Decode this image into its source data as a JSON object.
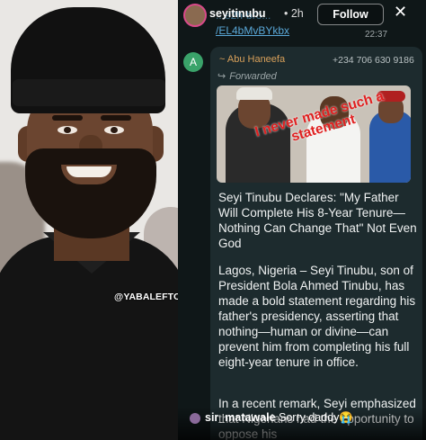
{
  "story": {
    "username": "seyitinubu",
    "age": "2h",
    "follow_label": "Follow",
    "close_glyph": "✕"
  },
  "chat": {
    "partial_link_line1": "...e2h-bro...",
    "partial_link_line2": "/EL4bMvBYkbx",
    "time": "22:37",
    "avatar_letter": "A",
    "sender": "~ Abu Haneefa",
    "phone": "+234 706 630 9186",
    "forwarded_label": "Forwarded",
    "stamp_text": "I never made such a statement",
    "headline": "Seyi Tinubu Declares: \"My Father Will Complete His 8-Year Tenure—Nothing Can Change That\" Not Even God",
    "paragraph1": "Lagos, Nigeria – Seyi Tinubu, son of President Bola Ahmed Tinubu, has made a bold statement regarding his father's presidency, asserting that nothing—human or divine—can prevent him from completing his full eight-year tenure in office.",
    "paragraph2": "In a recent remark, Seyi emphasized that Nigerians had the opportunity to oppose his"
  },
  "photo_watermark": "@YABALEFTONLINE",
  "comment": {
    "user": "sir_matawale",
    "text": "Sorry daddy😭"
  },
  "colors": {
    "bubble": "#1d2b2e",
    "sender": "#d8a05a",
    "link": "#5aa8d8",
    "stamp": "#e02020"
  }
}
